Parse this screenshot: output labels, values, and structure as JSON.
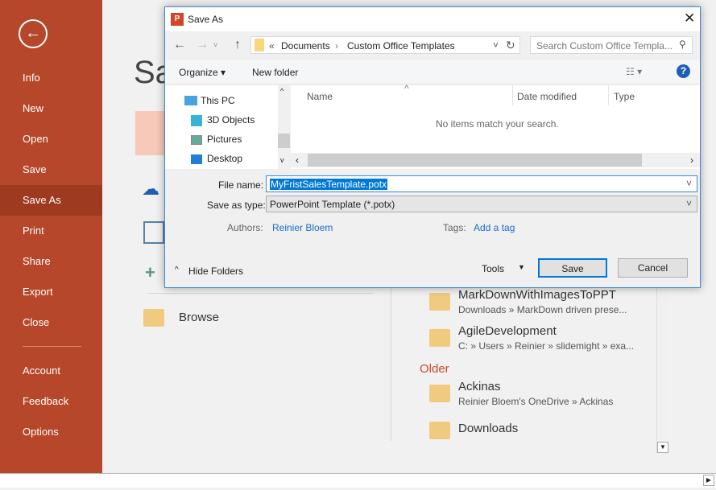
{
  "sidebar": {
    "items": [
      "Info",
      "New",
      "Open",
      "Save",
      "Save As",
      "Print",
      "Share",
      "Export",
      "Close",
      "Account",
      "Feedback",
      "Options"
    ],
    "selected": "Save As"
  },
  "backstage": {
    "title_partial": "Sa",
    "browse": "Browse",
    "older_label": "Older",
    "recent": [
      {
        "name": "MarkDownWithImagesToPPT",
        "path": "Downloads » MarkDown driven prese..."
      },
      {
        "name": "AgileDevelopment",
        "path": "C: » Users » Reinier » slidemight » exa..."
      }
    ],
    "older": [
      {
        "name": "Ackinas",
        "path": "Reinier Bloem's OneDrive » Ackinas"
      },
      {
        "name": "Downloads",
        "path": ""
      }
    ]
  },
  "dialog": {
    "title": "Save As",
    "breadcrumb": [
      "«",
      "Documents",
      "›",
      "Custom Office Templates"
    ],
    "search_placeholder": "Search Custom Office Templa...",
    "organize": "Organize ▾",
    "new_folder": "New folder",
    "nav": [
      "This PC",
      "3D Objects",
      "Pictures",
      "Desktop"
    ],
    "columns": [
      "Name",
      "Date modified",
      "Type"
    ],
    "empty": "No items match your search.",
    "file_name_label": "File name:",
    "file_name": "MyFristSalesTemplate.potx",
    "type_label": "Save as type:",
    "type_value": "PowerPoint Template (*.potx)",
    "authors_label": "Authors:",
    "authors": "Reinier Bloem",
    "tags_label": "Tags:",
    "tags": "Add a tag",
    "hide_folders": "Hide Folders",
    "tools": "Tools",
    "save": "Save",
    "cancel": "Cancel"
  },
  "colors": {
    "accent": "#b7472a",
    "dialog_border": "#3c8ad8",
    "link": "#1a6dc9"
  }
}
